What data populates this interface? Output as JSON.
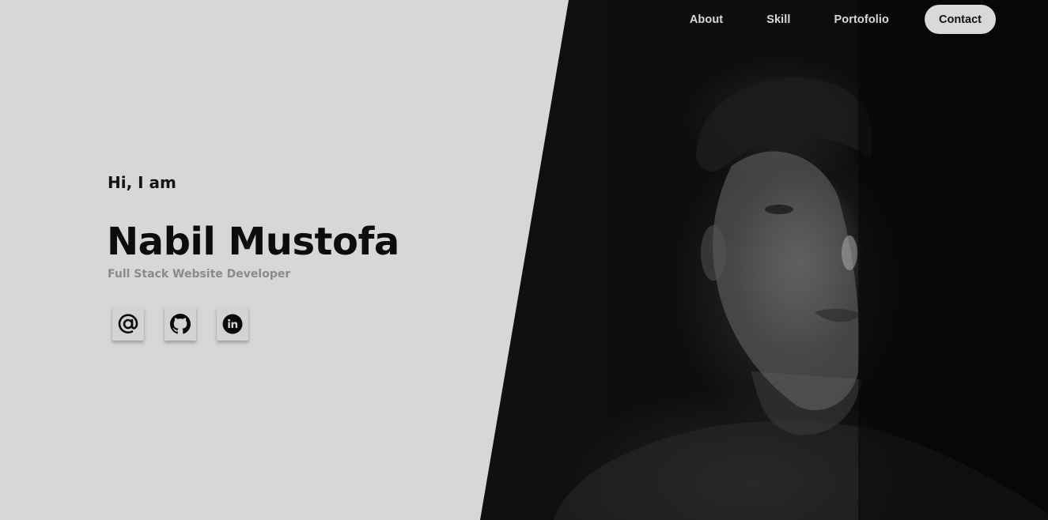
{
  "nav": {
    "links": [
      {
        "label": "About"
      },
      {
        "label": "Skill"
      },
      {
        "label": "Portofolio"
      }
    ],
    "contact_label": "Contact"
  },
  "hero": {
    "greeting": "Hi, I am",
    "name": "Nabil Mustofa",
    "role": "Full Stack Website Developer"
  },
  "socials": [
    {
      "icon": "at-sign-icon"
    },
    {
      "icon": "github-icon"
    },
    {
      "icon": "linkedin-icon"
    }
  ],
  "colors": {
    "background": "#d7d7d7",
    "panel": "#101010",
    "nav_text": "#d9d9d9",
    "contact_bg": "#d9d9d9",
    "name_text": "#0c0c0c",
    "role_text": "#8a8a8a"
  }
}
